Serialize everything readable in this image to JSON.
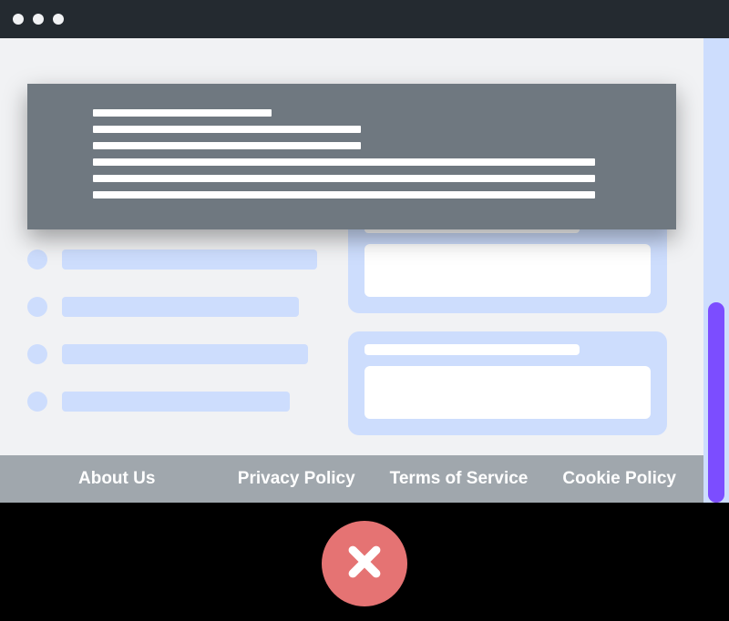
{
  "footer": {
    "links": [
      {
        "label": "About Us"
      },
      {
        "label": "Privacy Policy"
      },
      {
        "label": "Terms of Service"
      },
      {
        "label": "Cookie Policy"
      }
    ]
  },
  "status_icon": "error-cross",
  "status_meaning": "incorrect-example"
}
